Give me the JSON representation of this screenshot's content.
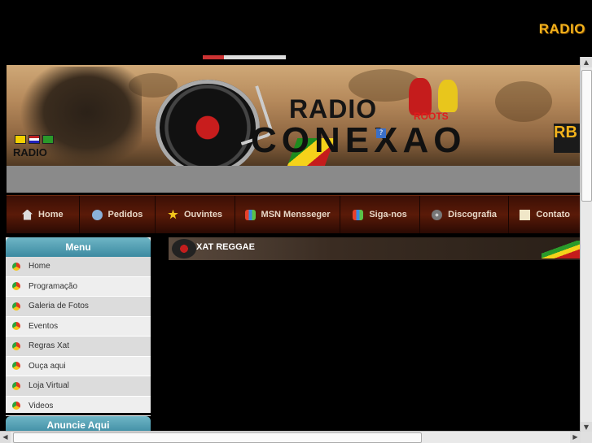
{
  "corner_logo": "RADIO",
  "banner": {
    "radio_word": "RADIO",
    "conexao_word": "CONEXAO",
    "small_brand": "RADIO",
    "roots_text": "ROOTS",
    "rb_text": "RB",
    "help": "?"
  },
  "nav": {
    "items": [
      {
        "label": "Home",
        "icon": "home-icon"
      },
      {
        "label": "Pedidos",
        "icon": "gear-icon"
      },
      {
        "label": "Ouvintes",
        "icon": "star-icon"
      },
      {
        "label": "MSN Mensseger",
        "icon": "msn-icon"
      },
      {
        "label": "Siga-nos",
        "icon": "msn-icon"
      },
      {
        "label": "Discografia",
        "icon": "disc-icon"
      },
      {
        "label": "Contato",
        "icon": "mail-icon"
      }
    ]
  },
  "menu": {
    "title": "Menu",
    "items": [
      {
        "label": "Home"
      },
      {
        "label": "Programação"
      },
      {
        "label": "Galeria de Fotos"
      },
      {
        "label": "Eventos"
      },
      {
        "label": "Regras Xat"
      },
      {
        "label": "Ouça aqui"
      },
      {
        "label": "Loja Virtual"
      },
      {
        "label": "Videos"
      }
    ]
  },
  "ads": {
    "title": "Anuncie Aqui"
  },
  "xat": {
    "title": "XAT REGGAE"
  },
  "colors": {
    "accent": "#f2b21c",
    "menu_head": "#3c8aa1",
    "nav_bg": "#3b0f05"
  }
}
